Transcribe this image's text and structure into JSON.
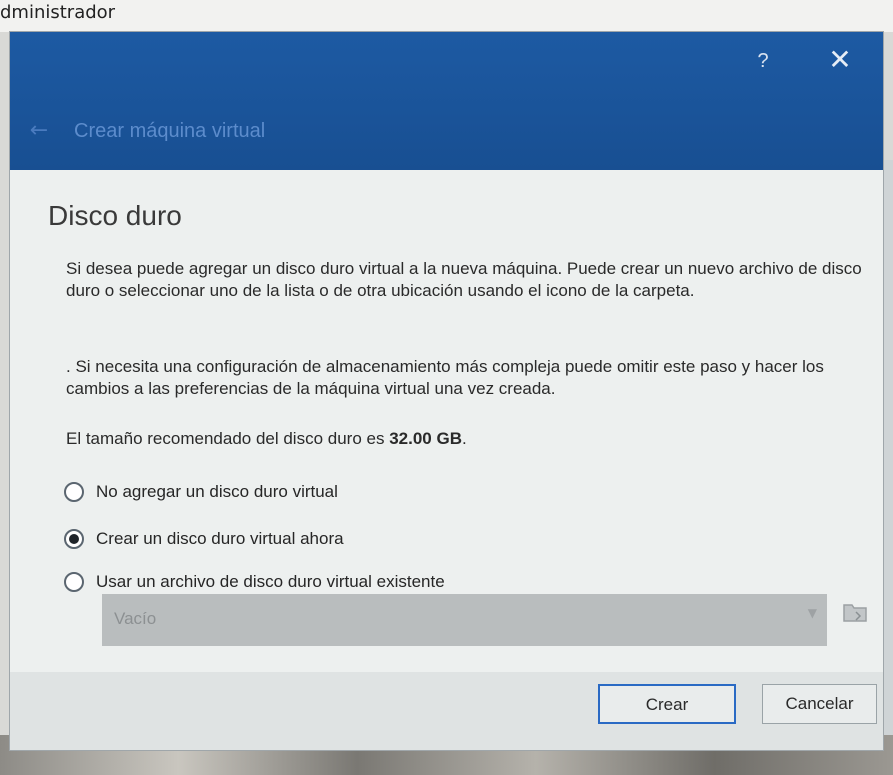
{
  "window": {
    "top_title": "dministrador"
  },
  "dialog": {
    "title": "Crear máquina virtual",
    "help_label": "?",
    "close_label": "✕",
    "back_label": "←",
    "section_title": "Disco duro",
    "paragraph1": "Si desea puede agregar un disco duro virtual a la nueva máquina. Puede crear un nuevo archivo de disco duro o seleccionar uno de la lista o de otra ubicación usando el icono de la carpeta.",
    "paragraph2": ". Si necesita una configuración de almacenamiento más compleja puede omitir este paso y hacer los cambios a las preferencias de la máquina virtual una vez creada.",
    "paragraph3_prefix": "El tamaño recomendado del disco duro es ",
    "paragraph3_size": "32.00 GB",
    "paragraph3_suffix": ".",
    "options": [
      {
        "label": "No agregar un disco duro virtual",
        "checked": false
      },
      {
        "label": "Crear un disco duro virtual ahora",
        "checked": true
      },
      {
        "label": "Usar un archivo de disco duro virtual existente",
        "checked": false
      }
    ],
    "disk_select": {
      "value": "Vacío",
      "arrow": "▼"
    },
    "folder_icon": "folder-icon",
    "buttons": {
      "create": "Crear",
      "cancel": "Cancelar"
    }
  },
  "colors": {
    "header": "#1d5aa3",
    "dialog_bg": "#edf0ef",
    "default_button_border": "#2a6ac4"
  }
}
